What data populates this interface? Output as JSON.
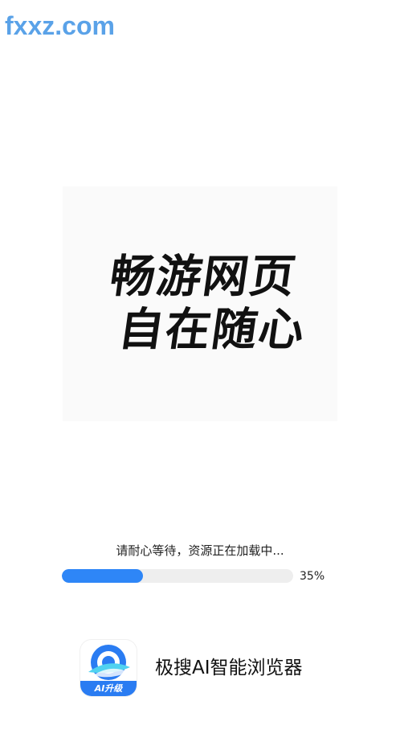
{
  "watermark": {
    "text": "fxxz.com"
  },
  "splash": {
    "slogan_line1": "畅游网页",
    "slogan_line2": "自在随心"
  },
  "loading": {
    "message": "请耐心等待，资源正在加载中...",
    "progress_percent": 35,
    "progress_label": "35%"
  },
  "app": {
    "icon": "jisou-browser-logo-icon",
    "icon_badge": "AI升级",
    "name": "极搜AI智能浏览器"
  },
  "colors": {
    "accent": "#2e86f7",
    "track": "#eeeeee",
    "watermark": "#5aa2e8"
  }
}
